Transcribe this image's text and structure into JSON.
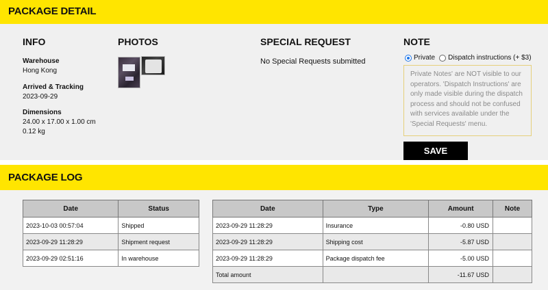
{
  "package_detail": {
    "banner": "PACKAGE DETAIL",
    "info": {
      "heading": "INFO",
      "warehouse_label": "Warehouse",
      "warehouse_value": "Hong Kong",
      "arrived_label": "Arrived & Tracking",
      "arrived_value": "2023-09-29",
      "dimensions_label": "Dimensions",
      "dimensions_value": "24.00 x 17.00 x 1.00 cm",
      "weight_value": "0.12 kg"
    },
    "photos": {
      "heading": "PHOTOS"
    },
    "special_request": {
      "heading": "SPECIAL REQUEST",
      "text": "No Special Requests submitted"
    },
    "note": {
      "heading": "NOTE",
      "option_private": "Private",
      "option_dispatch": "Dispatch instructions (+ $3)",
      "selected": "Private",
      "placeholder": "Private Notes' are NOT visible to our operators. 'Dispatch Instructions' are only made visible during the dispatch process and should not be confused with services available under the 'Special Requests' menu.",
      "save_label": "SAVE"
    }
  },
  "package_log": {
    "banner": "PACKAGE LOG",
    "status_table": {
      "headers": [
        "Date",
        "Status"
      ],
      "rows": [
        [
          "2023-10-03 00:57:04",
          "Shipped"
        ],
        [
          "2023-09-29 11:28:29",
          "Shipment request"
        ],
        [
          "2023-09-29 02:51:16",
          "In warehouse"
        ]
      ]
    },
    "cost_table": {
      "headers": [
        "Date",
        "Type",
        "Amount",
        "Note"
      ],
      "rows": [
        [
          "2023-09-29 11:28:29",
          "Insurance",
          "-0.80 USD",
          ""
        ],
        [
          "2023-09-29 11:28:29",
          "Shipping cost",
          "-5.87 USD",
          ""
        ],
        [
          "2023-09-29 11:28:29",
          "Package dispatch fee",
          "-5.00 USD",
          ""
        ]
      ],
      "total_label": "Total amount",
      "total_value": "-11.67 USD"
    }
  },
  "colors": {
    "banner": "#ffe500",
    "button": "#000000"
  }
}
